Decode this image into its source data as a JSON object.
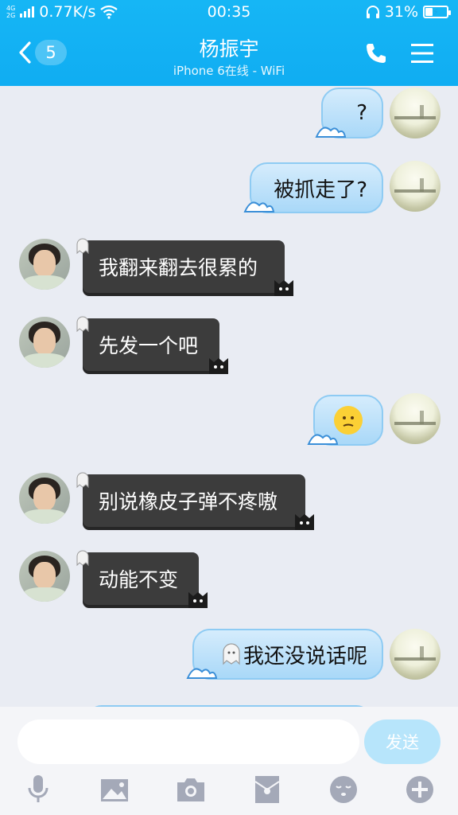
{
  "status": {
    "network": "4G",
    "network2": "2G",
    "speed": "0.77K/s",
    "time": "00:35",
    "battery": "31%",
    "battery_level": 0.31
  },
  "header": {
    "back_count": "5",
    "title": "杨振宇",
    "subtitle": "iPhone 6在线 - WiFi",
    "icons": [
      "back-chevron-icon",
      "phone-icon",
      "menu-icon"
    ]
  },
  "messages": [
    {
      "side": "out",
      "text": "?"
    },
    {
      "side": "out",
      "text": "被抓走了?"
    },
    {
      "side": "in",
      "text": "我翻来翻去很累的"
    },
    {
      "side": "in",
      "text": "先发一个吧"
    },
    {
      "side": "out",
      "text": "",
      "emoji": "emoji-face-icon"
    },
    {
      "side": "in",
      "text": "别说橡皮子弹不疼嗷"
    },
    {
      "side": "in",
      "text": "动能不变"
    },
    {
      "side": "out",
      "text": "我还没说话呢"
    }
  ],
  "input": {
    "value": "",
    "placeholder": "",
    "send_label": "发送"
  },
  "toolbar": [
    "mic-icon",
    "image-icon",
    "camera-icon",
    "red-packet-icon",
    "emoji-icon",
    "plus-icon"
  ],
  "colors": {
    "header": "#10adf2",
    "bubble_out": "#a9d8f8",
    "bubble_in": "#3c3c3c",
    "background": "#e9ecf3"
  }
}
